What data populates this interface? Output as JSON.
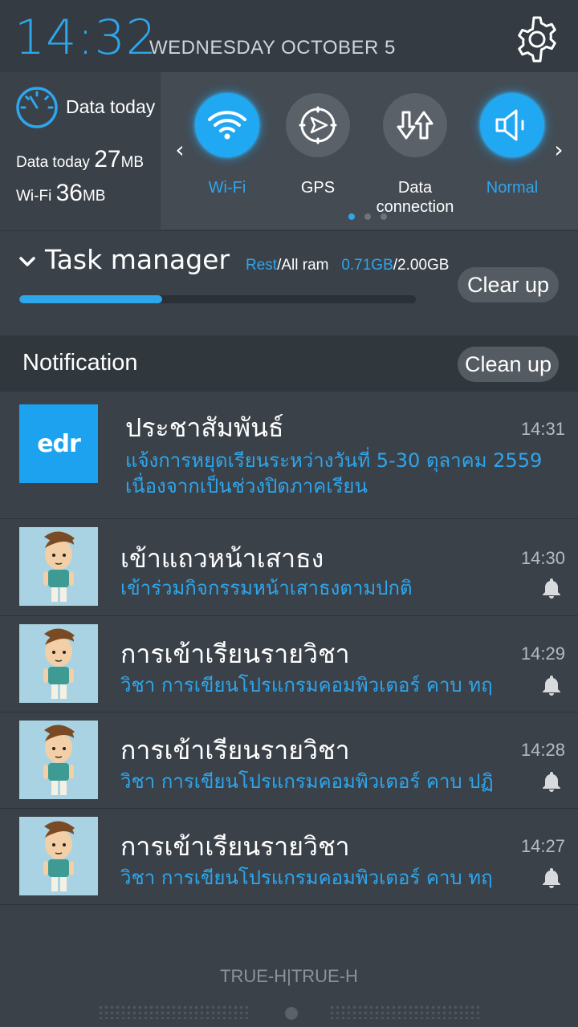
{
  "header": {
    "time": "14:32",
    "date": "WEDNESDAY  OCTOBER 5",
    "settings_icon": "gear-icon"
  },
  "data_usage": {
    "title": "Data today",
    "row1_label": "Data today",
    "row1_value": "27",
    "row1_unit": "MB",
    "row2_label": "Wi-Fi",
    "row2_value": "36",
    "row2_unit": "MB"
  },
  "toggles": [
    {
      "label": "Wi-Fi",
      "icon": "wifi-icon",
      "active": true
    },
    {
      "label": "GPS",
      "icon": "gps-icon",
      "active": false
    },
    {
      "label": "Data\nconnection",
      "icon": "data-connection-icon",
      "active": false
    },
    {
      "label": "Normal",
      "icon": "volume-icon",
      "active": true
    }
  ],
  "toggles_page": {
    "current": 1,
    "total": 3
  },
  "task_manager": {
    "title": "Task manager",
    "rest_label": "Rest",
    "all_ram_label": "/All ram",
    "rest_value": "0.71GB",
    "total_value": "/2.00GB",
    "usage_fraction": 0.36,
    "clear_label": "Clear up"
  },
  "notifications": {
    "title": "Notification",
    "clean_label": "Clean up",
    "items": [
      {
        "thumb": "edr-logo",
        "logo_text": "edr",
        "title": "ประชาสัมพันธ์",
        "time": "14:31",
        "body": "แจ้งการหยุดเรียนระหว่างวันที่ 5-30 ตุลาคม 2559 เนื่องจากเป็นช่วงปิดภาคเรียน"
      },
      {
        "thumb": "cartoon-boy-avatar",
        "title": "เข้าแถวหน้าเสาธง",
        "time": "14:30",
        "body": "เข้าร่วมกิจกรรมหน้าเสาธงตามปกติ"
      },
      {
        "thumb": "cartoon-boy-avatar",
        "title": "การเข้าเรียนรายวิชา",
        "time": "14:29",
        "body": "วิชา การเขียนโปรแกรมคอมพิวเตอร์ คาบ ทฤ"
      },
      {
        "thumb": "cartoon-boy-avatar",
        "title": "การเข้าเรียนรายวิชา",
        "time": "14:28",
        "body": "วิชา การเขียนโปรแกรมคอมพิวเตอร์ คาบ ปฏิ"
      },
      {
        "thumb": "cartoon-boy-avatar",
        "title": "การเข้าเรียนรายวิชา",
        "time": "14:27",
        "body": "วิชา การเขียนโปรแกรมคอมพิวเตอร์ คาบ ทฤ"
      }
    ]
  },
  "footer": {
    "carrier": "TRUE-H|TRUE-H"
  },
  "colors": {
    "accent": "#2ea6ec",
    "background": "#3a4149",
    "header_bg": "#343b42",
    "toggle_panel_bg": "#444b53"
  }
}
